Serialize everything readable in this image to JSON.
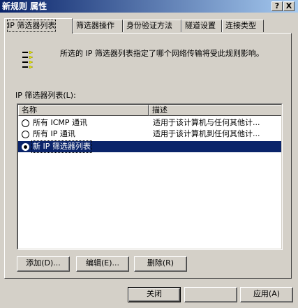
{
  "window": {
    "title": "新规则 属性",
    "help_label": "?",
    "close_label": "X"
  },
  "tabs": [
    {
      "label": "IP 筛选器列表",
      "active": true
    },
    {
      "label": "筛选器操作",
      "active": false
    },
    {
      "label": "身份验证方法",
      "active": false
    },
    {
      "label": "隧道设置",
      "active": false
    },
    {
      "label": "连接类型",
      "active": false
    }
  ],
  "panel": {
    "description": "所选的 IP 筛选器列表指定了哪个网络传输将受此规则影响。",
    "list_label": "IP 筛选器列表(L):",
    "columns": {
      "name": "名称",
      "description": "描述"
    },
    "rows": [
      {
        "name": "所有 ICMP 通讯",
        "description": "适用于该计算机与任何其他计...",
        "checked": false,
        "selected": false
      },
      {
        "name": "所有 IP 通讯",
        "description": "适用于该计算机到任何其他计...",
        "checked": false,
        "selected": false
      },
      {
        "name": "新 IP 筛选器列表",
        "description": "",
        "checked": true,
        "selected": true
      }
    ],
    "buttons": {
      "add": "添加(D)...",
      "edit": "编辑(E)...",
      "remove": "删除(R)"
    }
  },
  "footer": {
    "close": "关闭",
    "blank": "",
    "apply": "应用(A)"
  },
  "colors": {
    "title_bar": "#0a246a",
    "selection": "#0a246a",
    "face": "#d4d0c8",
    "icon_arrow": "#e8e800"
  }
}
